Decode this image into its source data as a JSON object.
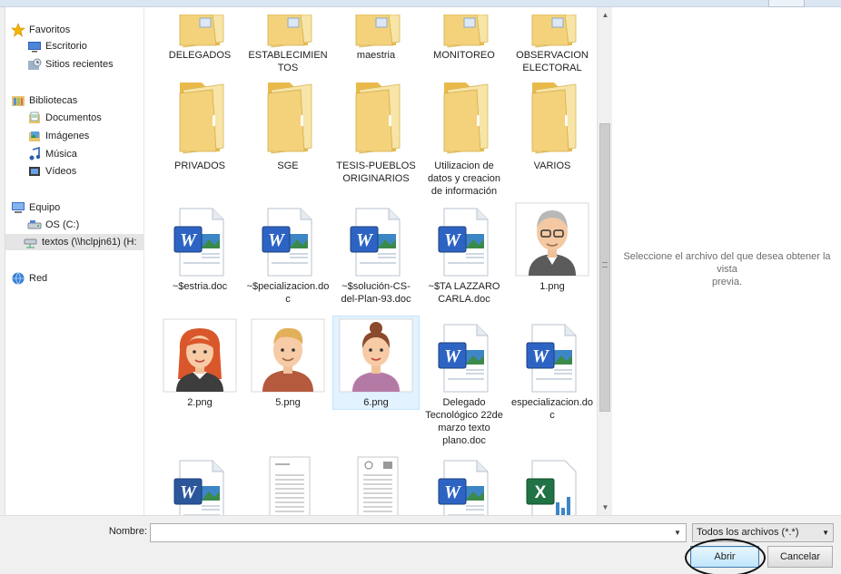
{
  "colors": {
    "folder": "#f3d27b",
    "word_blue": "#2b579a",
    "excel_green": "#217346",
    "selection": "#cce8ff"
  },
  "nav": {
    "items": [
      {
        "label": "Favoritos",
        "icon": "star-icon"
      },
      {
        "label": "Escritorio",
        "icon": "desktop-icon"
      },
      {
        "label": "Sitios recientes",
        "icon": "recent-places-icon"
      },
      {
        "label": "Bibliotecas",
        "icon": "libraries-icon"
      },
      {
        "label": "Documentos",
        "icon": "documents-icon"
      },
      {
        "label": "Imágenes",
        "icon": "pictures-icon"
      },
      {
        "label": "Música",
        "icon": "music-icon"
      },
      {
        "label": "Vídeos",
        "icon": "videos-icon"
      },
      {
        "label": "Equipo",
        "icon": "computer-icon"
      },
      {
        "label": "OS (C:)",
        "icon": "drive-icon"
      },
      {
        "label": "textos (\\\\hclpjn61) (H:",
        "icon": "network-drive-icon",
        "selected": true
      },
      {
        "label": "Red",
        "icon": "network-icon"
      }
    ]
  },
  "files": [
    {
      "name": "DELEGADOS",
      "type": "folder"
    },
    {
      "name": "ESTABLECIMIENTOS",
      "type": "folder"
    },
    {
      "name": "maestria",
      "type": "folder"
    },
    {
      "name": "MONITOREO",
      "type": "folder"
    },
    {
      "name": "OBSERVACION ELECTORAL",
      "type": "folder"
    },
    {
      "name": "PRIVADOS",
      "type": "folder"
    },
    {
      "name": "SGE",
      "type": "folder"
    },
    {
      "name": "TESIS-PUEBLOS ORIGINARIOS",
      "type": "folder"
    },
    {
      "name": "Utilizacion de datos y creacion de información",
      "type": "folder"
    },
    {
      "name": "VARIOS",
      "type": "folder"
    },
    {
      "name": "~$estria.doc",
      "type": "word"
    },
    {
      "name": "~$pecializacion.doc",
      "type": "word"
    },
    {
      "name": "~$solución-CS-del-Plan-93.doc",
      "type": "word"
    },
    {
      "name": "~$TA LAZZARO CARLA.doc",
      "type": "word"
    },
    {
      "name": "1.png",
      "type": "avatar-old-man"
    },
    {
      "name": "2.png",
      "type": "avatar-woman-red"
    },
    {
      "name": "5.png",
      "type": "avatar-man"
    },
    {
      "name": "6.png",
      "type": "avatar-woman",
      "selected": true
    },
    {
      "name": "Delegado Tecnológico 22de marzo texto plano.doc",
      "type": "word"
    },
    {
      "name": "especializacion.doc",
      "type": "word"
    },
    {
      "name": "",
      "type": "word-new"
    },
    {
      "name": "",
      "type": "document"
    },
    {
      "name": "",
      "type": "document-seal"
    },
    {
      "name": "",
      "type": "word"
    },
    {
      "name": "",
      "type": "excel"
    }
  ],
  "preview": {
    "message": "Seleccione el archivo del que desea obtener la vista\nprevia."
  },
  "footer": {
    "name_label": "Nombre:",
    "name_value": "",
    "file_type": "Todos los archivos (*.*)",
    "open_label": "Abrir",
    "cancel_label": "Cancelar"
  }
}
